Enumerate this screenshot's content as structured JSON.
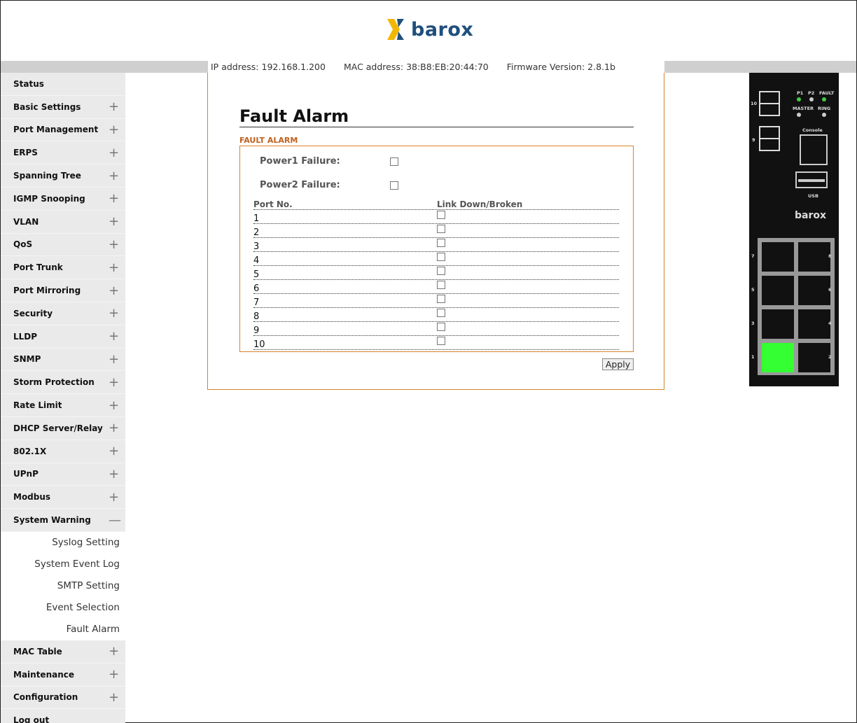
{
  "brand": {
    "name": "barox",
    "accent": "#1f4f7c",
    "mark_color": "#f2b705"
  },
  "infobar": {
    "ip": "IP address: 192.168.1.200",
    "mac": "MAC address: 38:B8:EB:20:44:70",
    "firmware": "Firmware Version: 2.8.1b"
  },
  "sidebar": {
    "items": [
      {
        "label": "Status",
        "sym": ""
      },
      {
        "label": "Basic Settings",
        "sym": "+"
      },
      {
        "label": "Port Management",
        "sym": "+"
      },
      {
        "label": "ERPS",
        "sym": "+"
      },
      {
        "label": "Spanning Tree",
        "sym": "+"
      },
      {
        "label": "IGMP Snooping",
        "sym": "+"
      },
      {
        "label": "VLAN",
        "sym": "+"
      },
      {
        "label": "QoS",
        "sym": "+"
      },
      {
        "label": "Port Trunk",
        "sym": "+"
      },
      {
        "label": "Port Mirroring",
        "sym": "+"
      },
      {
        "label": "Security",
        "sym": "+"
      },
      {
        "label": "LLDP",
        "sym": "+"
      },
      {
        "label": "SNMP",
        "sym": "+"
      },
      {
        "label": "Storm Protection",
        "sym": "+"
      },
      {
        "label": "Rate Limit",
        "sym": "+"
      },
      {
        "label": "DHCP Server/Relay",
        "sym": "+"
      },
      {
        "label": "802.1X",
        "sym": "+"
      },
      {
        "label": "UPnP",
        "sym": "+"
      },
      {
        "label": "Modbus",
        "sym": "+"
      },
      {
        "label": "System Warning",
        "sym": "—"
      }
    ],
    "sub_items": [
      "Syslog Setting",
      "System Event Log",
      "SMTP Setting",
      "Event Selection",
      "Fault Alarm"
    ],
    "items_after": [
      {
        "label": "MAC Table",
        "sym": "+"
      },
      {
        "label": "Maintenance",
        "sym": "+"
      },
      {
        "label": "Configuration",
        "sym": "+"
      },
      {
        "label": "Log out",
        "sym": ""
      }
    ]
  },
  "main": {
    "title": "Fault Alarm",
    "section": "FAULT ALARM",
    "power1_label": "Power1 Failure:",
    "power2_label": "Power2 Failure:",
    "table": {
      "col_port": "Port No.",
      "col_link": "Link Down/Broken",
      "ports": [
        "1",
        "2",
        "3",
        "4",
        "5",
        "6",
        "7",
        "8",
        "9",
        "10"
      ]
    },
    "apply_label": "Apply"
  },
  "device": {
    "leds": [
      "P1",
      "P2",
      "FAULT"
    ],
    "leds2": [
      "MASTER",
      "RING"
    ],
    "console": "Console",
    "usb": "USB",
    "brand": "barox",
    "sfp_labels": [
      "10",
      "9"
    ],
    "port_labels": [
      "7",
      "8",
      "5",
      "6",
      "3",
      "4",
      "1",
      "2"
    ],
    "link_color": "#33ff33"
  }
}
